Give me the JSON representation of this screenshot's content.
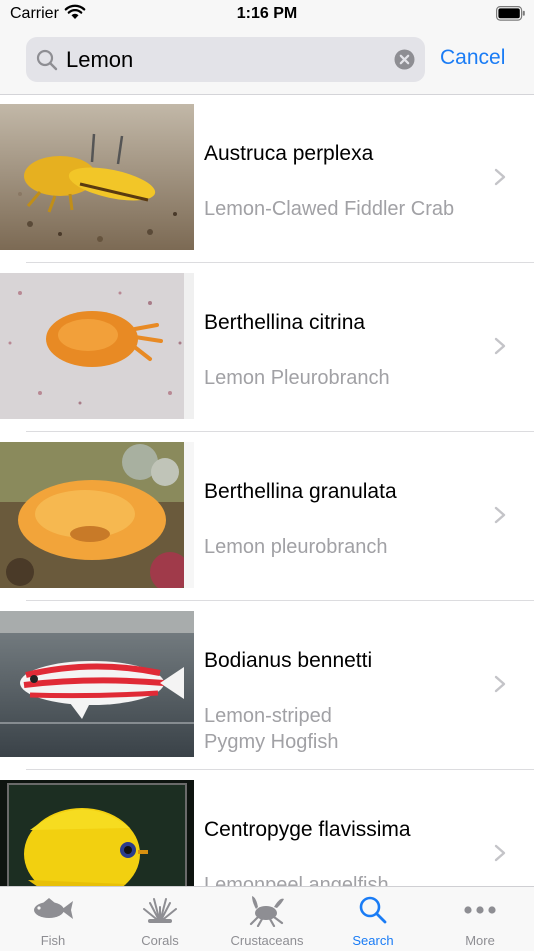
{
  "status_bar": {
    "carrier": "Carrier",
    "time": "1:16 PM"
  },
  "search": {
    "query": "Lemon",
    "cancel_label": "Cancel"
  },
  "results": [
    {
      "scientific_name": "Austruca perplexa",
      "common_name": "Lemon-Clawed Fiddler Crab"
    },
    {
      "scientific_name": "Berthellina citrina",
      "common_name": "Lemon Pleurobranch"
    },
    {
      "scientific_name": "Berthellina granulata",
      "common_name": "Lemon pleurobranch"
    },
    {
      "scientific_name": "Bodianus bennetti",
      "common_name": "Lemon-striped\nPygmy Hogfish"
    },
    {
      "scientific_name": "Centropyge flavissima",
      "common_name": "Lemonpeel angelfish"
    }
  ],
  "tabs": [
    {
      "label": "Fish",
      "icon": "fish-icon"
    },
    {
      "label": "Corals",
      "icon": "coral-icon"
    },
    {
      "label": "Crustaceans",
      "icon": "crab-icon"
    },
    {
      "label": "Search",
      "icon": "search-icon",
      "active": true
    },
    {
      "label": "More",
      "icon": "more-icon"
    }
  ],
  "colors": {
    "accent": "#1a7cf5",
    "secondary_text": "#a1a1a5",
    "search_field": "#e3e3e8"
  }
}
